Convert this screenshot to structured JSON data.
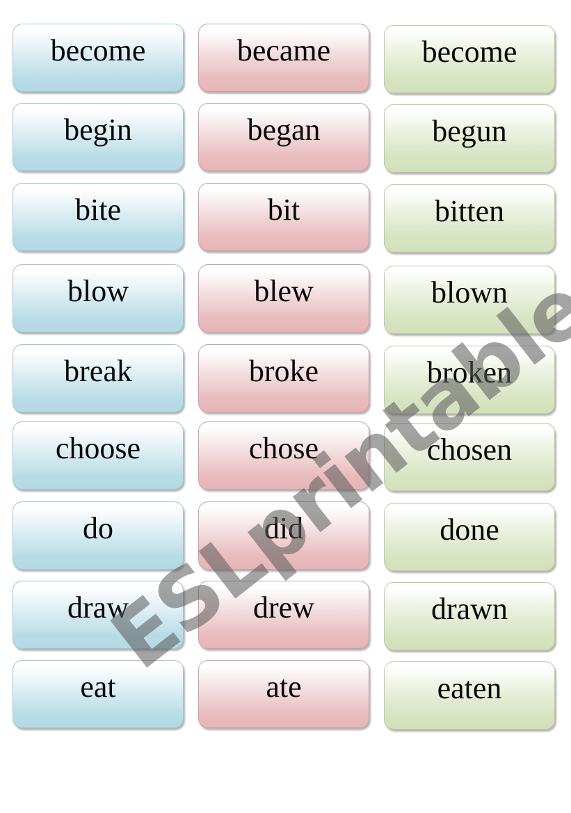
{
  "columns": [
    "base",
    "past",
    "past_participle"
  ],
  "rows": [
    {
      "base": "become",
      "past": "became",
      "past_participle": "become"
    },
    {
      "base": "begin",
      "past": "began",
      "past_participle": "begun"
    },
    {
      "base": "bite",
      "past": "bit",
      "past_participle": "bitten"
    },
    {
      "base": "blow",
      "past": "blew",
      "past_participle": "blown"
    },
    {
      "base": "break",
      "past": "broke",
      "past_participle": "broken"
    },
    {
      "base": "choose",
      "past": "chose",
      "past_participle": "chosen"
    },
    {
      "base": "do",
      "past": "did",
      "past_participle": "done"
    },
    {
      "base": "draw",
      "past": "drew",
      "past_participle": "drawn"
    },
    {
      "base": "eat",
      "past": "ate",
      "past_participle": "eaten"
    }
  ],
  "colors": {
    "base_card": "#b3d9e4",
    "past_card": "#e6b5b7",
    "past_participle_card": "#d3e0bb"
  },
  "watermark": "ESLprintables.com"
}
